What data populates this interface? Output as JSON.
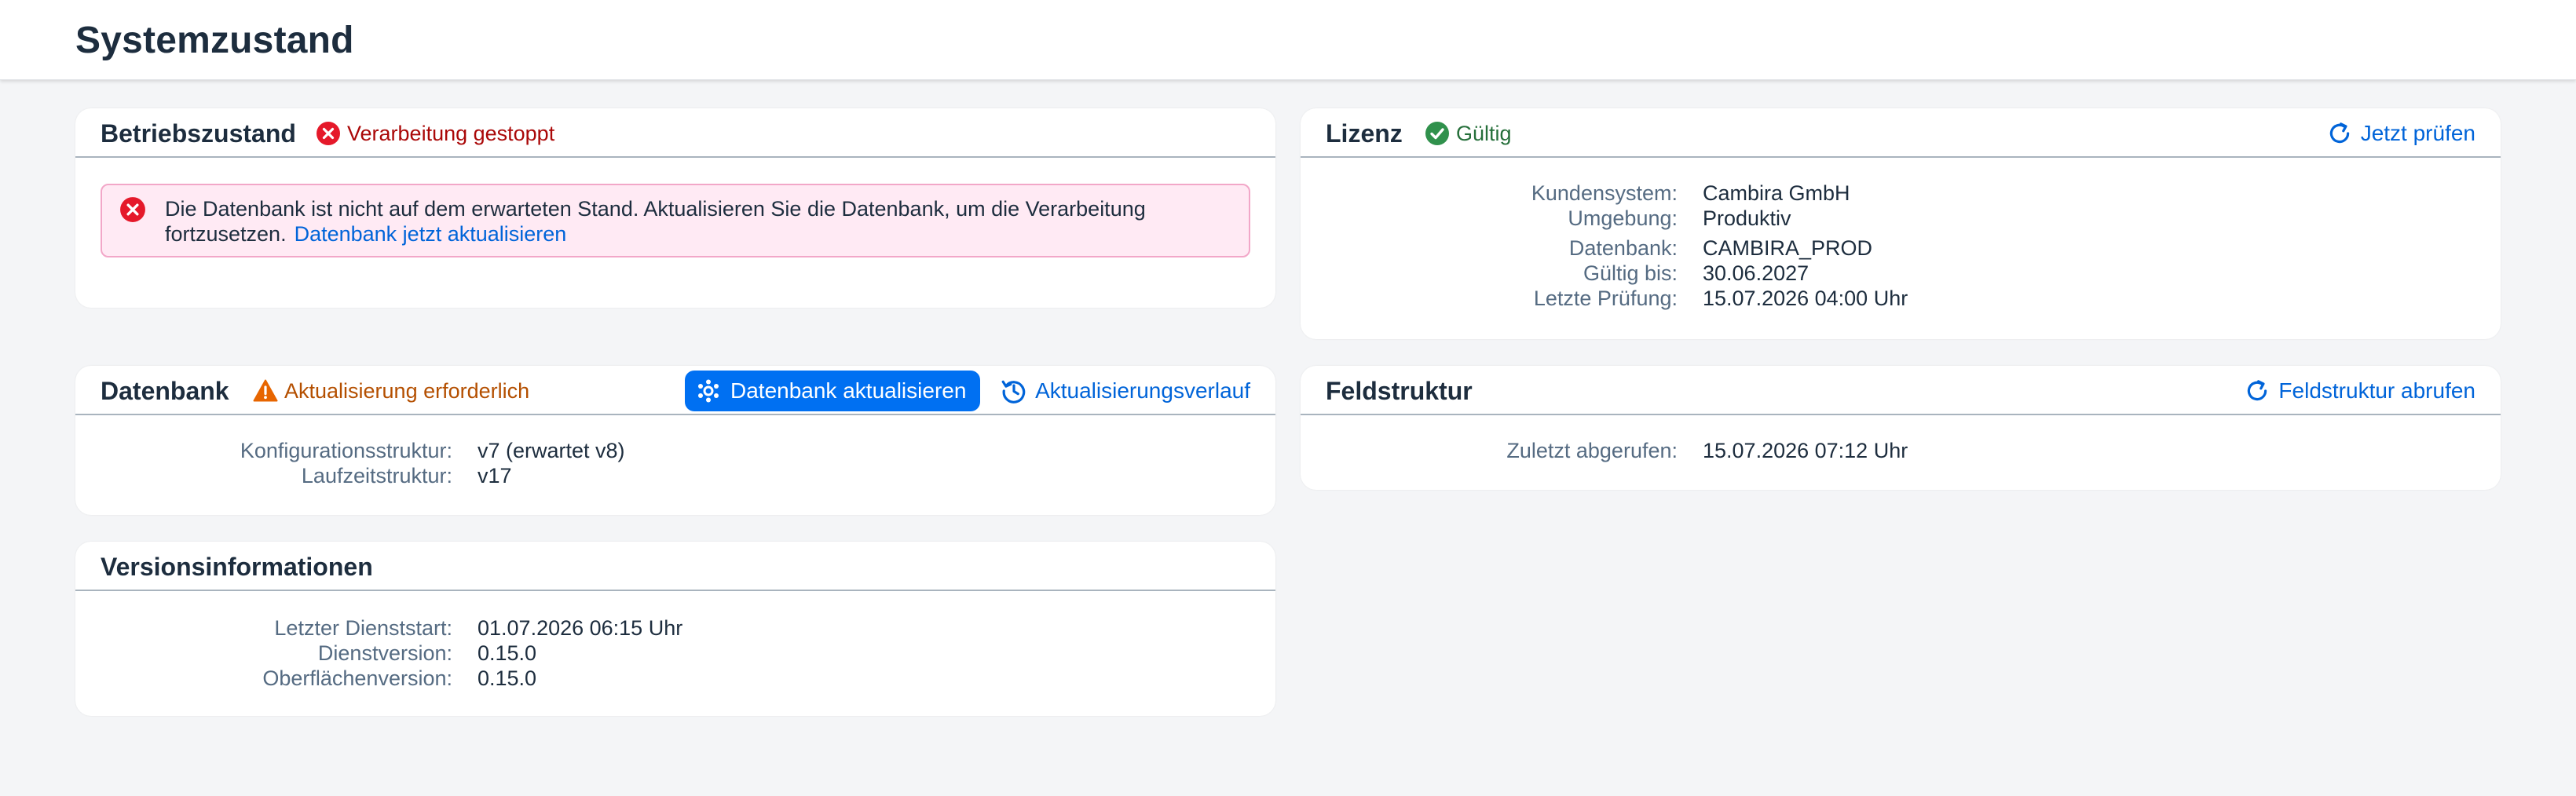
{
  "page": {
    "title": "Systemzustand"
  },
  "betrieb": {
    "title": "Betriebszustand",
    "status": "Verarbeitung gestoppt",
    "message": "Die Datenbank ist nicht auf dem erwarteten Stand. Aktualisieren Sie die Datenbank, um die Verarbeitung fortzusetzen.",
    "message_link": "Datenbank jetzt aktualisieren"
  },
  "lizenz": {
    "title": "Lizenz",
    "status": "Gültig",
    "action": "Jetzt prüfen",
    "fields": [
      {
        "label": "Kundensystem:",
        "value": "Cambira GmbH"
      },
      {
        "label": "Umgebung:",
        "value": "Produktiv"
      },
      {
        "label": "Datenbank:",
        "value": "CAMBIRA_PROD"
      },
      {
        "label": "Gültig bis:",
        "value": "30.06.2027"
      },
      {
        "label": "Letzte Prüfung:",
        "value": "15.07.2026 04:00 Uhr"
      }
    ]
  },
  "datenbank": {
    "title": "Datenbank",
    "status": "Aktualisierung erforderlich",
    "primary_action": "Datenbank aktualisieren",
    "history_action": "Aktualisierungsverlauf",
    "fields": [
      {
        "label": "Konfigurationsstruktur:",
        "value": "v7 (erwartet v8)"
      },
      {
        "label": "Laufzeitstruktur:",
        "value": "v17"
      }
    ]
  },
  "feldstruktur": {
    "title": "Feldstruktur",
    "action": "Feldstruktur abrufen",
    "fields": [
      {
        "label": "Zuletzt abgerufen:",
        "value": "15.07.2026 07:12 Uhr"
      }
    ]
  },
  "version": {
    "title": "Versionsinformationen",
    "fields": [
      {
        "label": "Letzter Dienststart:",
        "value": "01.07.2026 06:15 Uhr"
      },
      {
        "label": "Dienstversion:",
        "value": "0.15.0"
      },
      {
        "label": "Oberflächenversion:",
        "value": "0.15.0"
      }
    ]
  },
  "colors": {
    "error": "#aa0808",
    "success": "#256f3a",
    "warning": "#b44f00",
    "link": "#0064d9",
    "primary": "#0070f2"
  }
}
